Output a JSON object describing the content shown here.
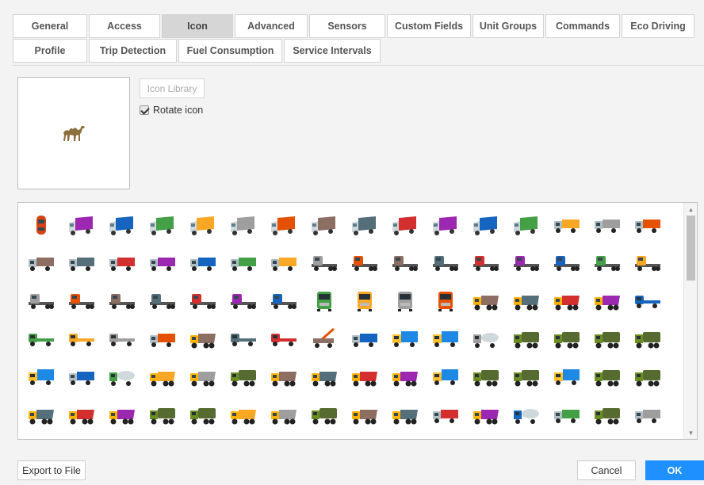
{
  "tabs_row1": [
    "General",
    "Access",
    "Icon",
    "Advanced",
    "Sensors",
    "Custom Fields",
    "Unit Groups",
    "Commands",
    "Eco Driving"
  ],
  "tabs_row2": [
    "Profile",
    "Trip Detection",
    "Fuel Consumption",
    "Service Intervals"
  ],
  "active_tab": "Icon",
  "icon_library_label": "Icon Library",
  "rotate_icon_label": "Rotate icon",
  "rotate_icon_checked": true,
  "selected_icon": "camel-icon",
  "export_label": "Export to File",
  "cancel_label": "Cancel",
  "ok_label": "OK",
  "colors": {
    "ok": "#1e90ff",
    "truck_palette": [
      "#d32f2f",
      "#9c27b0",
      "#1565c0",
      "#43a047",
      "#f9a825",
      "#9e9e9e",
      "#e65100",
      "#8d6e63",
      "#546e7a"
    ]
  },
  "icon_rows": [
    [
      "car-icon",
      "box-truck-red-icon",
      "box-truck-purple-icon",
      "box-truck-blue-icon",
      "box-truck-green-icon",
      "box-truck-yellow-icon",
      "box-truck-gray-icon",
      "box-truck-red-icon",
      "box-truck-purple-icon",
      "box-truck-blue-icon",
      "box-truck-green-icon",
      "box-truck-yellow-icon",
      "box-truck-gray-icon",
      "truck-icon",
      "truck-icon",
      "truck-icon"
    ],
    [
      "truck-icon",
      "truck-icon",
      "truck-icon",
      "truck-icon",
      "truck-icon",
      "truck-icon",
      "truck-icon",
      "semi-truck-icon",
      "semi-truck-icon",
      "semi-truck-icon",
      "semi-truck-icon",
      "trailer-truck-icon",
      "trailer-truck-icon",
      "trailer-truck-icon",
      "trailer-truck-icon",
      "semi-truck-icon"
    ],
    [
      "semi-truck-icon",
      "semi-truck-icon",
      "semi-truck-icon",
      "semi-truck-icon",
      "semi-truck-icon",
      "semi-truck-icon",
      "semi-truck-icon",
      "truck-front-icon",
      "truck-front-icon",
      "truck-front-icon",
      "truck-front-icon",
      "dump-truck-icon",
      "dump-truck-icon",
      "dump-truck-icon",
      "dump-truck-icon",
      "flatbed-truck-icon"
    ],
    [
      "flatbed-truck-icon",
      "flatbed-truck-icon",
      "flatbed-truck-icon",
      "truck-icon",
      "dump-truck-icon",
      "flatbed-truck-icon",
      "flatbed-truck-icon",
      "crane-truck-icon",
      "truck-icon",
      "cargo-truck-icon",
      "cargo-truck-icon",
      "tank-truck-icon",
      "military-truck-icon",
      "military-truck-icon",
      "military-truck-icon",
      "military-truck-icon"
    ],
    [
      "cargo-truck-icon",
      "truck-icon",
      "concrete-mixer-icon",
      "dump-truck-icon",
      "dump-truck-icon",
      "military-truck-icon",
      "dump-truck-icon",
      "dump-truck-icon",
      "dump-truck-icon",
      "dump-truck-icon",
      "cargo-truck-icon",
      "military-truck-icon",
      "military-truck-icon",
      "cargo-truck-icon",
      "military-truck-icon",
      "military-truck-icon"
    ],
    [
      "dump-truck-icon",
      "dump-truck-icon",
      "dump-truck-icon",
      "military-truck-icon",
      "military-truck-icon",
      "dump-truck-icon",
      "dump-truck-icon",
      "military-truck-icon",
      "dump-truck-icon",
      "dump-truck-icon",
      "truck-icon",
      "dump-truck-icon",
      "tank-truck-icon",
      "truck-icon",
      "military-truck-icon",
      "truck-icon"
    ]
  ]
}
